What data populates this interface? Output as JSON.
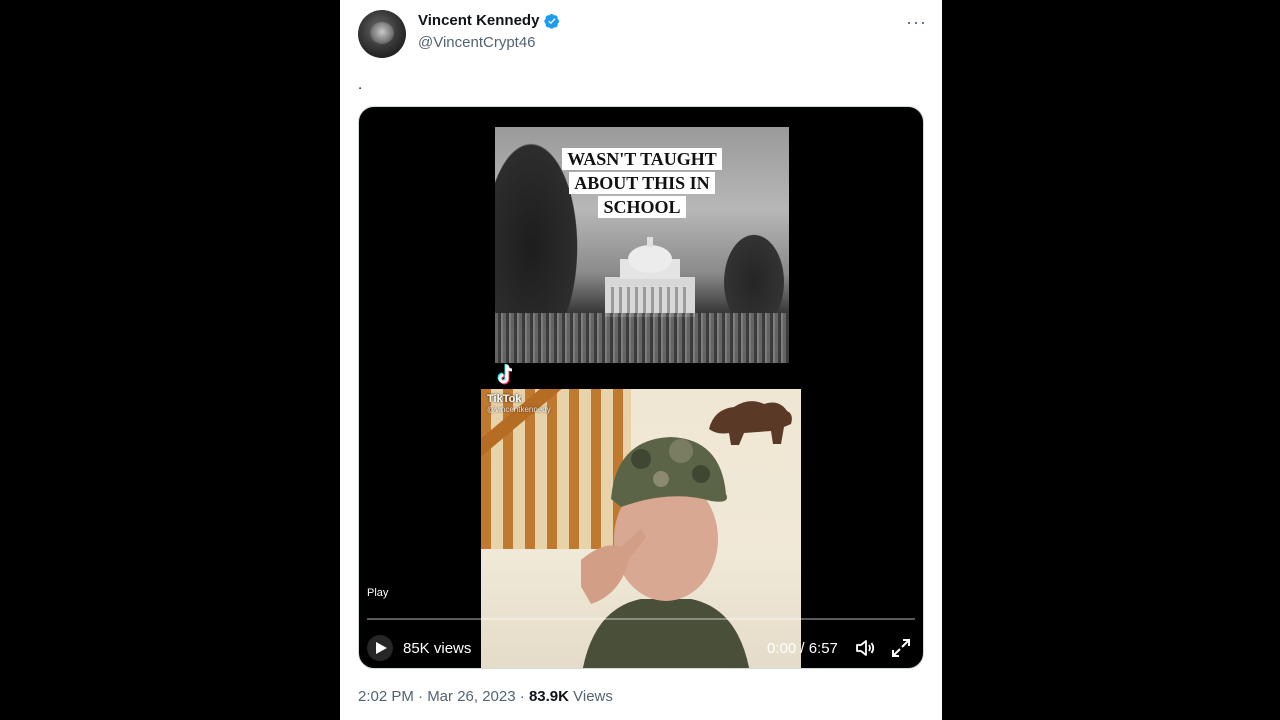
{
  "tweet": {
    "author_name": "Vincent Kennedy",
    "author_handle": "@VincentCrypt46",
    "text": ".",
    "timestamp": "2:02 PM · Mar 26, 2023",
    "separator": "·",
    "views_count": "83.9K",
    "views_label": "Views"
  },
  "video": {
    "caption": "WASN'T TAUGHT ABOUT THIS IN SCHOOL",
    "tiktok_label": "TikTok",
    "tiktok_user": "@vincentkennedy",
    "play_label": "Play",
    "views": "85K views",
    "time": "0:00 / 6:57",
    "progress": 0
  },
  "icons": {
    "verified": "verified-badge-icon",
    "more": "more-options-icon",
    "play": "play-icon",
    "volume": "volume-icon",
    "fullscreen": "fullscreen-icon",
    "tiktok": "tiktok-logo-icon"
  },
  "colors": {
    "verified_blue": "#1d9bf0",
    "text_primary": "#0f1419",
    "text_secondary": "#536471"
  }
}
